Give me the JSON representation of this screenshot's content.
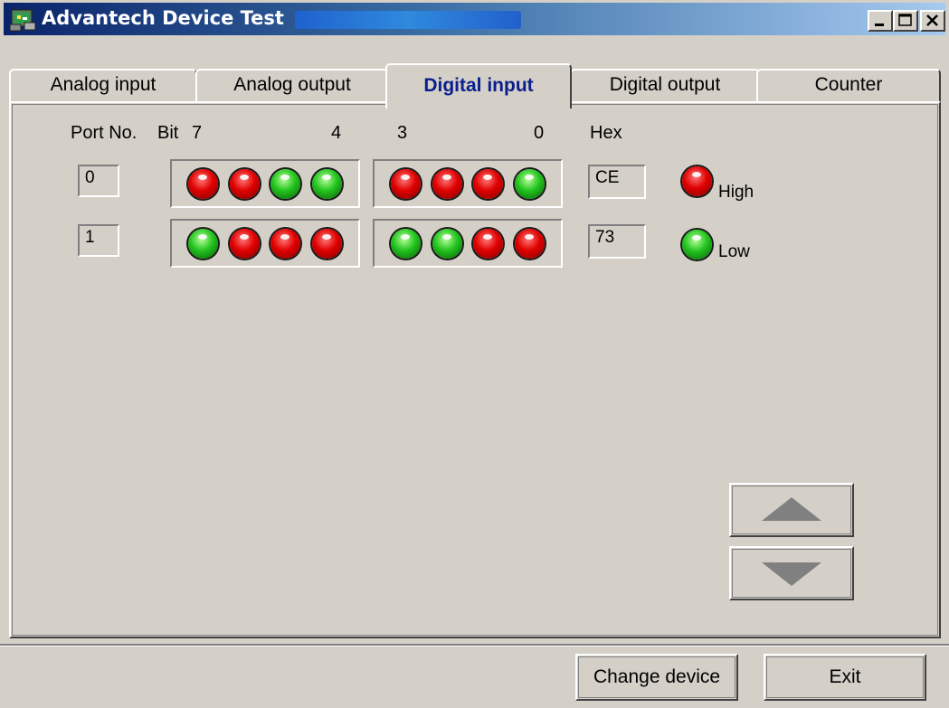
{
  "window": {
    "title": "Advantech Device Test",
    "icon": "app-icon",
    "controls": [
      "minimize-icon",
      "maximize-icon",
      "close-icon"
    ]
  },
  "tabs": [
    {
      "label": "Analog input",
      "active": false
    },
    {
      "label": "Analog output",
      "active": false
    },
    {
      "label": "Digital input",
      "active": true
    },
    {
      "label": "Digital output",
      "active": false
    },
    {
      "label": "Counter",
      "active": false
    }
  ],
  "digital_input": {
    "headers": {
      "port_no": "Port No.",
      "bit": "Bit",
      "bit7": "7",
      "bit4": "4",
      "bit3": "3",
      "bit0": "0",
      "hex": "Hex"
    },
    "ports": [
      {
        "port": "0",
        "hex": "CE",
        "bits": [
          "red",
          "red",
          "green",
          "green",
          "red",
          "red",
          "red",
          "green"
        ]
      },
      {
        "port": "1",
        "hex": "73",
        "bits": [
          "green",
          "red",
          "red",
          "red",
          "green",
          "green",
          "red",
          "red"
        ]
      }
    ],
    "legend": {
      "high": "High",
      "low": "Low",
      "high_color": "#e00000",
      "low_color": "#22c41e"
    }
  },
  "buttons": {
    "up": "arrow-up-icon",
    "down": "arrow-down-icon",
    "change_device": "Change device",
    "exit": "Exit"
  },
  "colors": {
    "face": "#d4d0c8",
    "titlebar_start": "#0a246a",
    "titlebar_end": "#a6caf0",
    "active_tab_text": "#0a1e8c"
  }
}
